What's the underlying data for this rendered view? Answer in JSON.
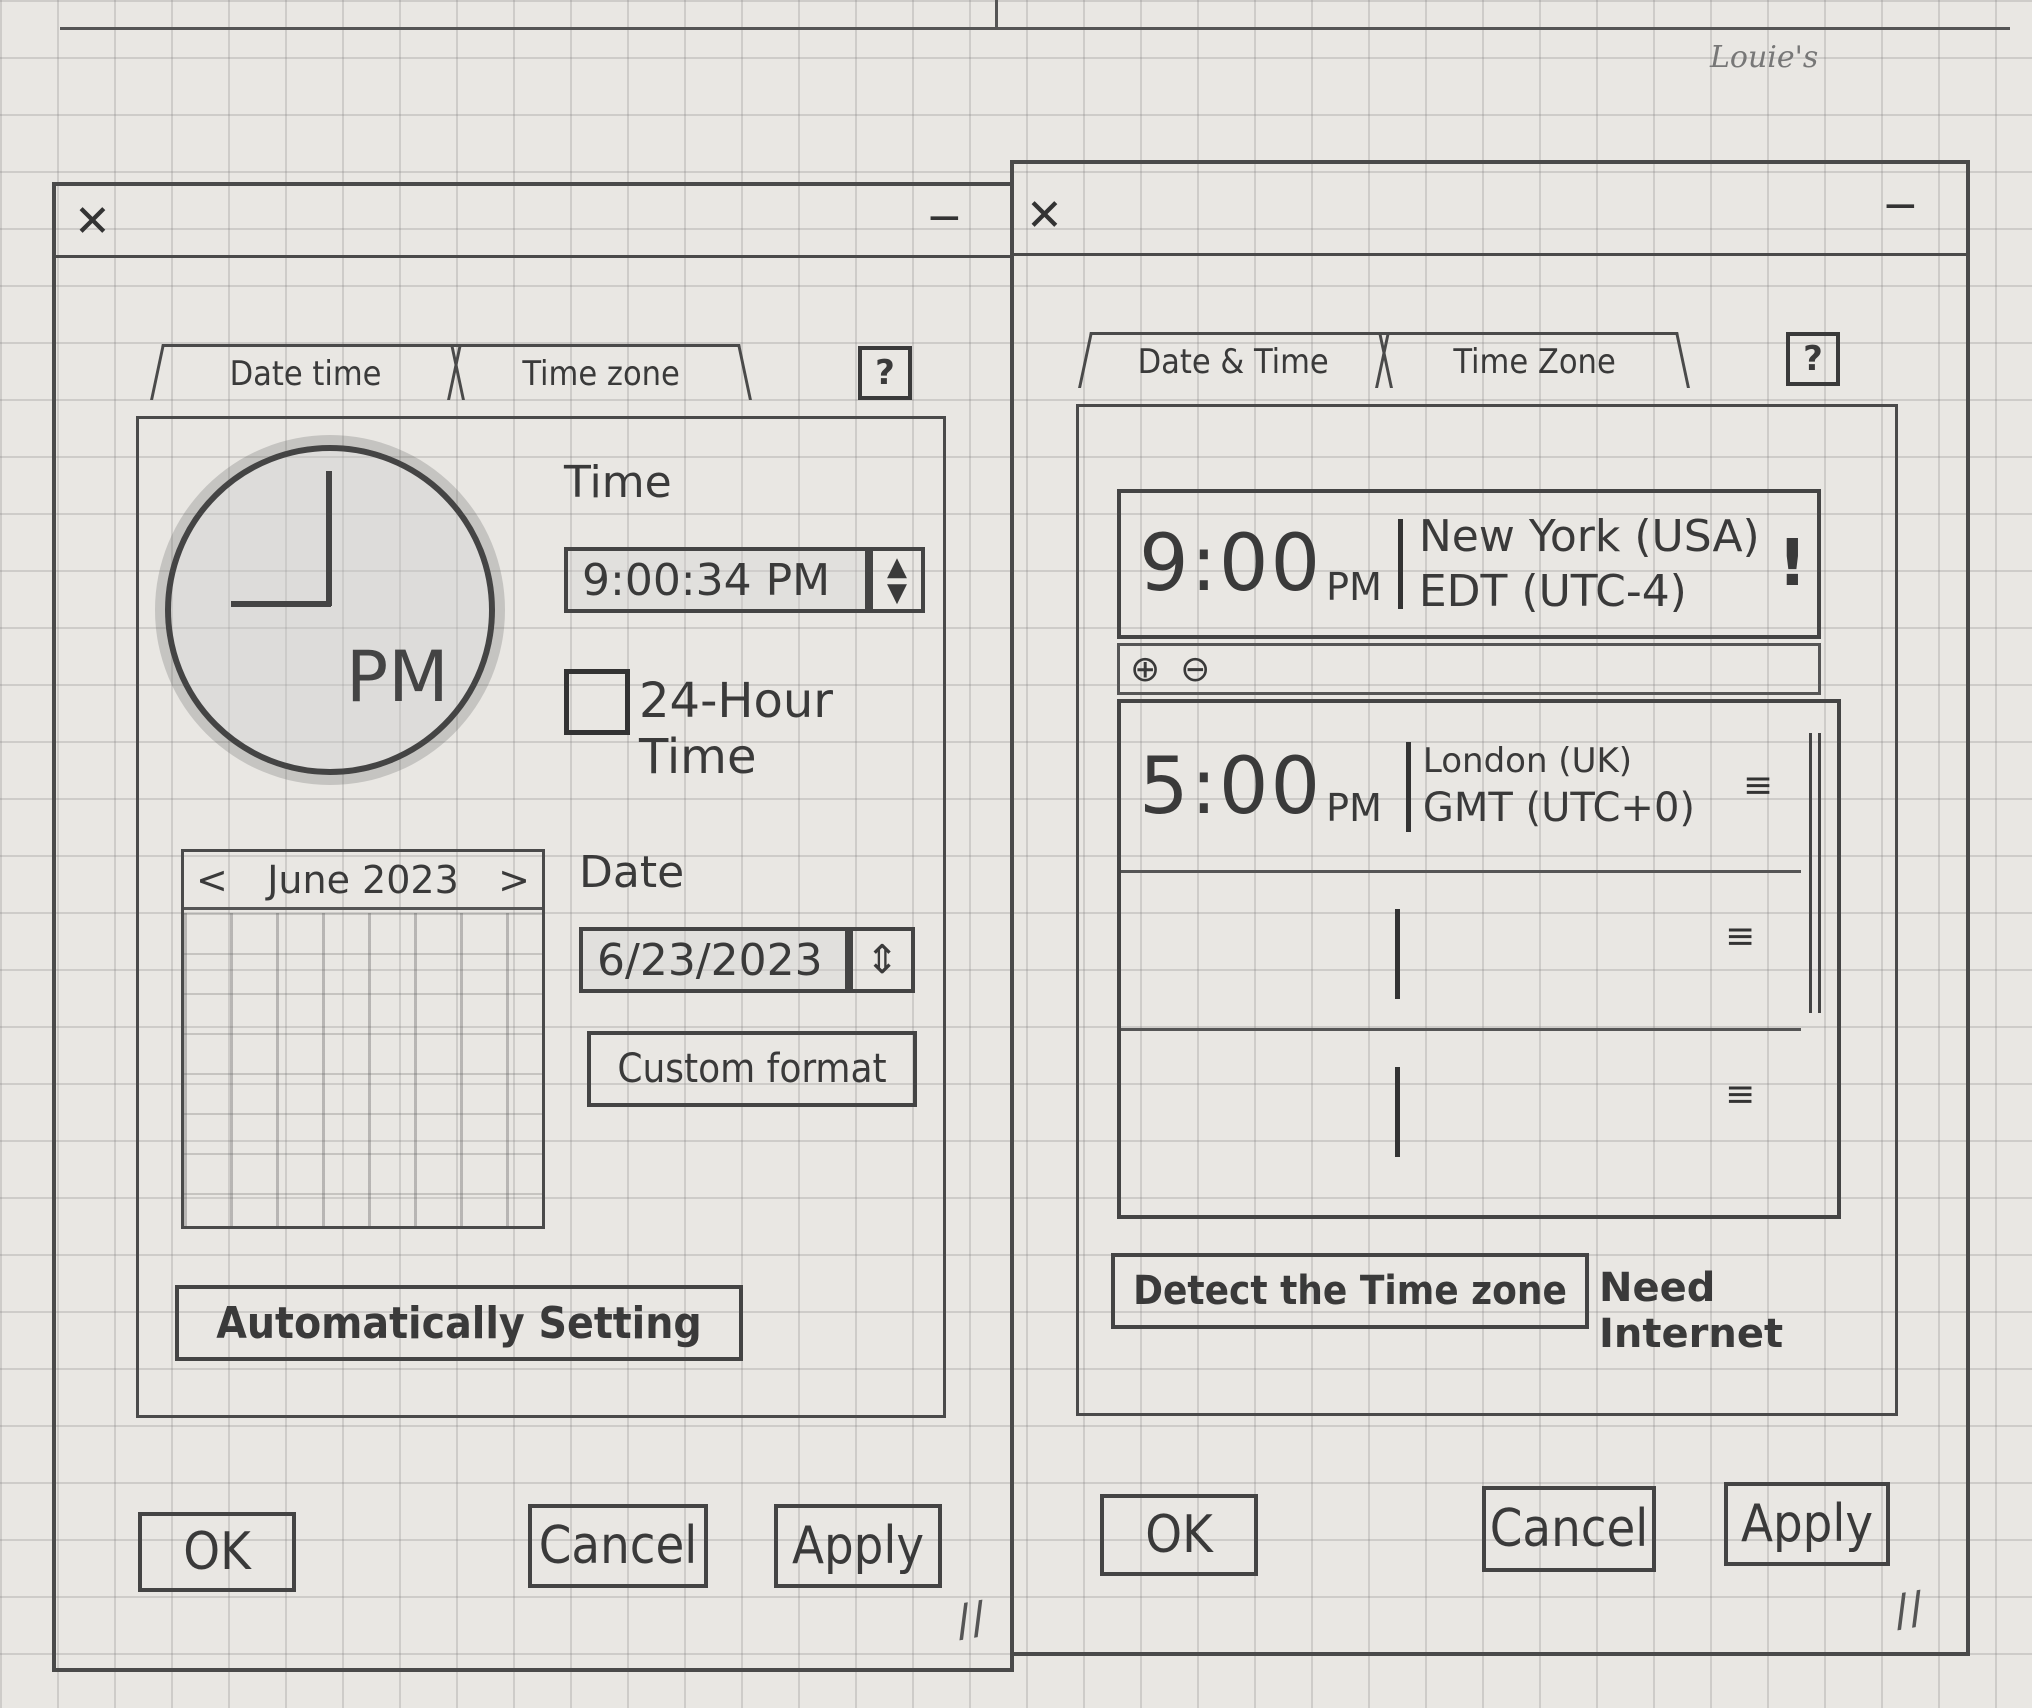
{
  "author": "Louie's",
  "left_window": {
    "close_glyph": "✕",
    "minimize_glyph": "−",
    "tabs": {
      "date_time": "Date time",
      "time_zone": "Time zone"
    },
    "help": "?",
    "clock": {
      "period": "PM"
    },
    "time": {
      "label": "Time",
      "value": "9:00:34 PM",
      "spin_up": "▲",
      "spin_down": "▼"
    },
    "hour24": {
      "label": "24-Hour Time",
      "checked": false
    },
    "calendar": {
      "prev": "<",
      "month": "June 2023",
      "next": ">"
    },
    "date": {
      "label": "Date",
      "value": "6/23/2023",
      "spin": "⇕"
    },
    "custom_format_button": "Custom format",
    "auto_button": "Automatically Setting",
    "ok": "OK",
    "cancel": "Cancel",
    "apply": "Apply",
    "resize_grip": "//"
  },
  "right_window": {
    "close_glyph": "✕",
    "minimize_glyph": "−",
    "tabs": {
      "date_time": "Date & Time",
      "time_zone": "Time Zone"
    },
    "help": "?",
    "primary_zone": {
      "time": "9:00",
      "ampm": "PM",
      "city": "New York (USA)",
      "zone": "EDT (UTC-4)",
      "alert": "!"
    },
    "add_icon": "⊕",
    "remove_icon": "⊖",
    "zones": [
      {
        "time": "5:00",
        "ampm": "PM",
        "city": "London (UK)",
        "zone": "GMT (UTC+0)"
      },
      {
        "time": "",
        "ampm": "",
        "city": "",
        "zone": ""
      },
      {
        "time": "",
        "ampm": "",
        "city": "",
        "zone": ""
      }
    ],
    "drag_handle": "≡",
    "detect_button": "Detect the Time zone",
    "need_internet": "Need Internet",
    "ok": "OK",
    "cancel": "Cancel",
    "apply": "Apply",
    "resize_grip": "//"
  }
}
